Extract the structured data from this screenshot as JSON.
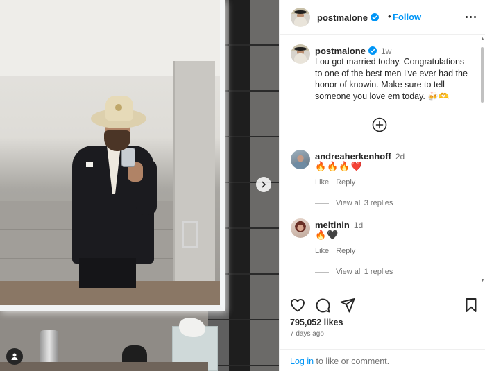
{
  "post": {
    "author": "postmalone",
    "follow_label": "Follow",
    "separator": "•",
    "caption": {
      "username": "postmalone",
      "time": "1w",
      "text": "Lou got married today. Congratulations to one of the best men I've ever had the honor of knowin. Make sure to tell someone you love em today. 🍻🫶"
    },
    "comments": [
      {
        "username": "andreaherkenhoff",
        "time": "2d",
        "text": "🔥🔥🔥❤️",
        "like_label": "Like",
        "reply_label": "Reply",
        "view_replies": "View all 3 replies"
      },
      {
        "username": "meltinin",
        "time": "1d",
        "text": "🔥🖤",
        "like_label": "Like",
        "reply_label": "Reply",
        "view_replies": "View all 1 replies"
      }
    ],
    "likes": "795,052 likes",
    "posted": "7 days ago",
    "login": {
      "link": "Log in",
      "suffix": " to like or comment."
    }
  },
  "colors": {
    "link_blue": "#0095f6",
    "verified_blue": "#0095f6",
    "text_primary": "#262626",
    "text_secondary": "#737373"
  },
  "icons": {
    "verified": "verified-badge-icon",
    "more": "more-options-icon",
    "load_more": "plus-circle-icon",
    "like": "heart-icon",
    "comment": "comment-bubble-icon",
    "share": "paper-plane-icon",
    "save": "bookmark-icon",
    "next": "chevron-right-icon",
    "tags": "user-tag-icon"
  }
}
